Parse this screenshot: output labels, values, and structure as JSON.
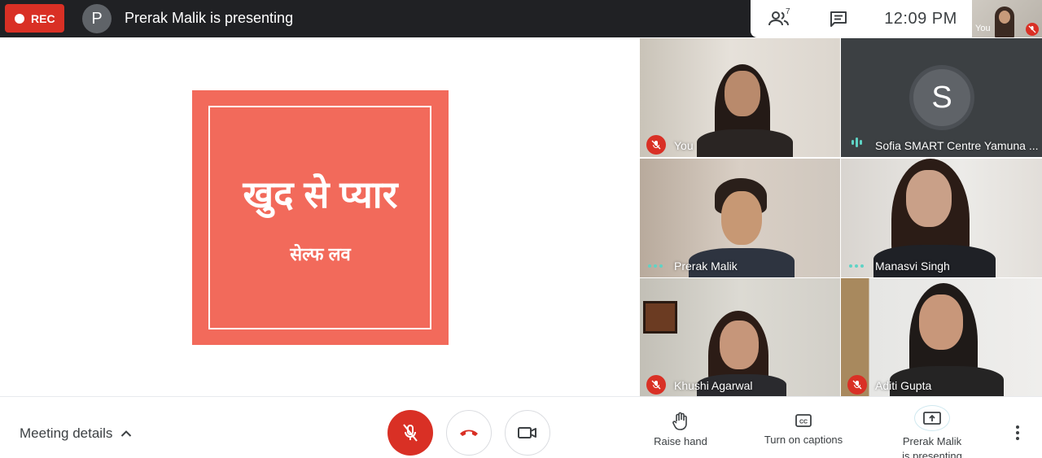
{
  "topbar": {
    "rec_label": "REC",
    "presenter_initial": "P",
    "presenting_text": "Prerak Malik is presenting",
    "people_count": "7",
    "time": "12:09  PM",
    "self_label": "You"
  },
  "slide": {
    "title": "खुद से प्यार",
    "subtitle": "सेल्फ लव",
    "background": "#f26a5b"
  },
  "participants": [
    {
      "name": "You",
      "status": "muted"
    },
    {
      "name": "Sofia SMART Centre Yamuna ...",
      "initial": "S",
      "status": "speaking"
    },
    {
      "name": "Prerak Malik",
      "status": "active"
    },
    {
      "name": "Manasvi Singh",
      "status": "active"
    },
    {
      "name": "Khushi Agarwal",
      "status": "muted"
    },
    {
      "name": "Aditi Gupta",
      "status": "muted"
    }
  ],
  "bottombar": {
    "meeting_details": "Meeting details",
    "raise_hand": "Raise hand",
    "captions": "Turn on captions",
    "present_line1": "Prerak Malik",
    "present_line2": "is presenting"
  },
  "colors": {
    "accent_red": "#d93025",
    "topbar_bg": "#202124",
    "speaking": "#5fd3c5"
  }
}
